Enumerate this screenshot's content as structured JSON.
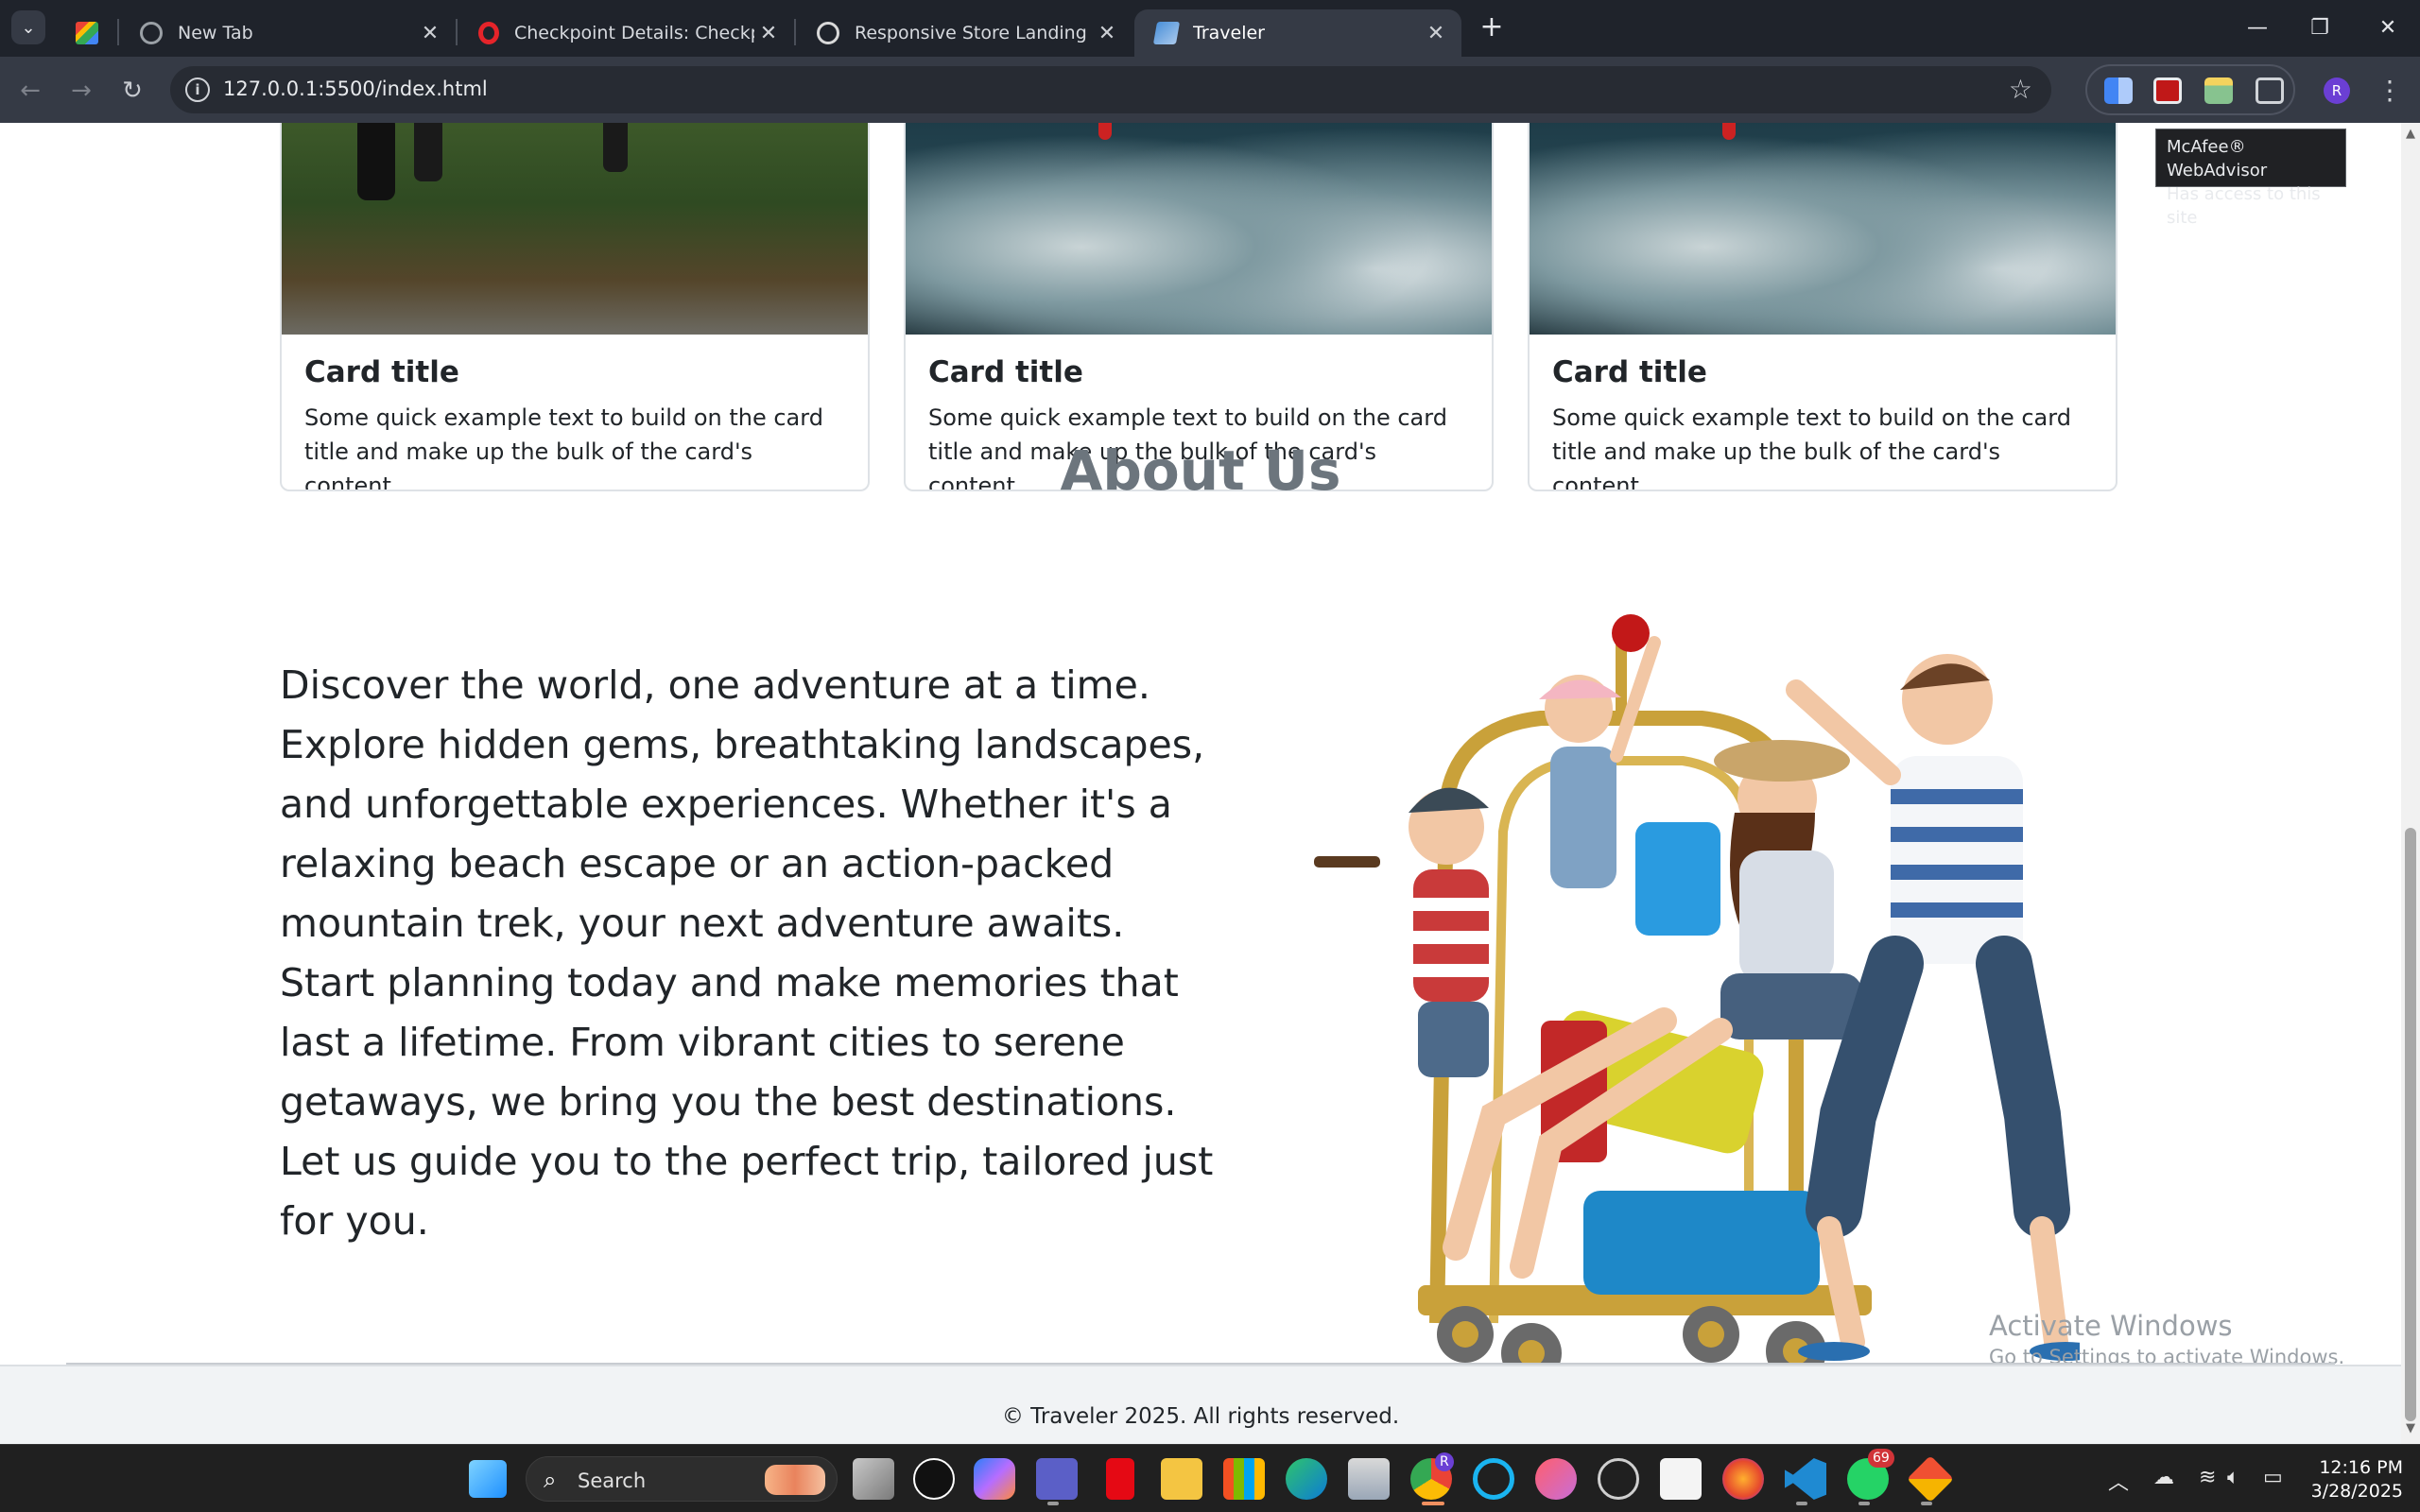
{
  "browser": {
    "tabs": [
      {
        "title": "",
        "favicon": "gmail-icon",
        "color": "#ea4335"
      },
      {
        "title": "New Tab",
        "favicon": "globe-icon",
        "color": "#9aa0a6"
      },
      {
        "title": "Checkpoint Details: Checkpoint",
        "favicon": "opera-icon",
        "color": "#e5242a"
      },
      {
        "title": "Responsive Store Landing Page",
        "favicon": "chatgpt-icon",
        "color": "#d9d9d9"
      },
      {
        "title": "Traveler",
        "favicon": "map-icon",
        "color": "#4a90d9",
        "active": true
      }
    ],
    "new_tab_label": "+",
    "url": "127.0.0.1:5500/index.html",
    "profile_initial": "R",
    "extension_tooltip": {
      "line1": "McAfee® WebAdvisor",
      "line2": "Has access to this site"
    }
  },
  "page": {
    "cards": [
      {
        "title": "Card title",
        "text": "Some quick example text to build on the card title and make up the bulk of the card's content.",
        "image": "runners"
      },
      {
        "title": "Card title",
        "text": "Some quick example text to build on the card title and make up the bulk of the card's content.",
        "image": "mountain"
      },
      {
        "title": "Card title",
        "text": "Some quick example text to build on the card title and make up the bulk of the card's content.",
        "image": "mountain"
      }
    ],
    "about": {
      "heading": "About Us",
      "paragraph": "Discover the world, one adventure at a time. Explore hidden gems, breathtaking landscapes, and unforgettable experiences. Whether it's a relaxing beach escape or an action-packed mountain trek, your next adventure awaits. Start planning today and make memories that last a lifetime. From vibrant cities to serene getaways, we bring you the best destinations. Let us guide you to the perfect trip, tailored just for you."
    },
    "footer": "© Traveler 2025. All rights reserved."
  },
  "watermark": {
    "line1": "Activate Windows",
    "line2": "Go to Settings to activate Windows."
  },
  "taskbar": {
    "search_label": "Search",
    "apps": [
      "start-icon",
      "search-box",
      "task-view-icon",
      "upwork-icon",
      "copilot-icon",
      "teams-icon",
      "netflix-icon",
      "file-explorer-icon",
      "store-icon",
      "edge-icon",
      "mail-icon",
      "chrome-icon",
      "cortana-icon",
      "itunes-icon",
      "dell-icon",
      "solitaire-icon",
      "firefox-icon",
      "vscode-icon",
      "whatsapp-icon",
      "git-icon"
    ],
    "whatsapp_badge": "69",
    "chrome_badge": "R",
    "time": "12:16 PM",
    "date": "3/28/2025"
  }
}
